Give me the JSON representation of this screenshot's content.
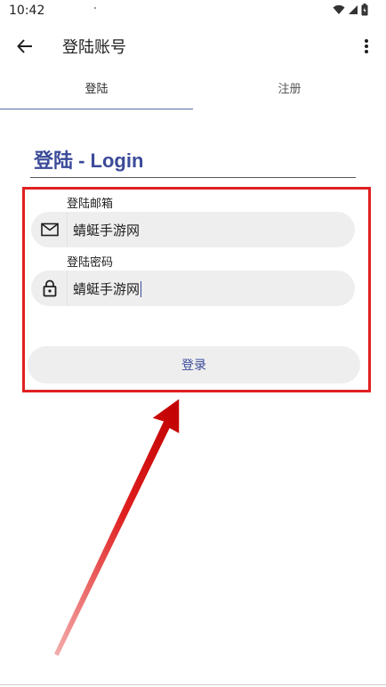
{
  "status_bar": {
    "time": "10:42",
    "icons": [
      "wifi-icon",
      "signal-icon",
      "battery-icon"
    ]
  },
  "app_bar": {
    "title": "登陆账号",
    "back_icon": "arrow-left-icon",
    "menu_icon": "more-vertical-icon"
  },
  "tabs": [
    {
      "label": "登陆",
      "selected": true
    },
    {
      "label": "注册",
      "selected": false
    }
  ],
  "form": {
    "heading": "登陆 - Login",
    "email": {
      "label": "登陆邮箱",
      "value": "蜻蜓手游网",
      "icon": "mail-icon"
    },
    "password": {
      "label": "登陆密码",
      "value": "蜻蜓手游网",
      "icon": "lock-icon"
    },
    "submit_label": "登录"
  },
  "colors": {
    "accent": "#3b4a99",
    "field_bg": "#eeeeee",
    "annotation_red": "#e02020"
  }
}
